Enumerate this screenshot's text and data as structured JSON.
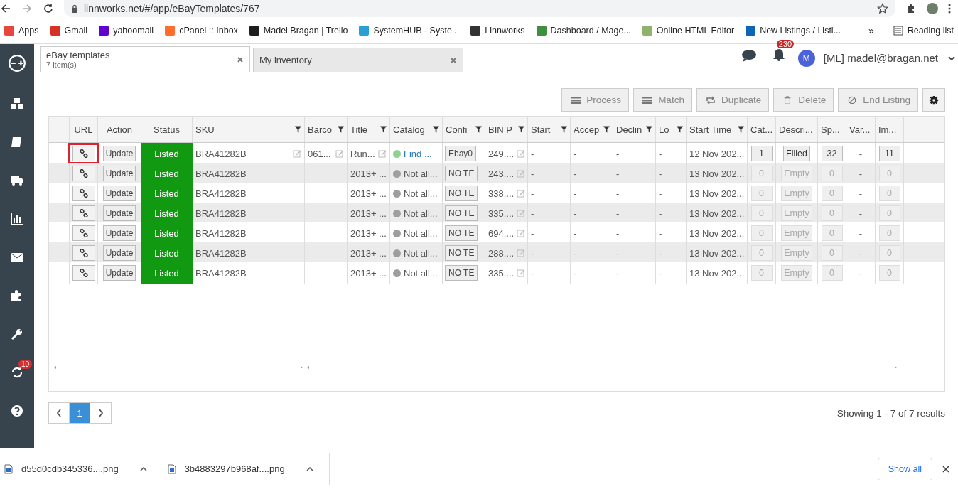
{
  "browser": {
    "url": "linnworks.net/#/app/eBayTemplates/767"
  },
  "bookmarks": [
    {
      "label": "Apps",
      "color": "#e8453c"
    },
    {
      "label": "Gmail",
      "color": "#d93025"
    },
    {
      "label": "yahoomail",
      "color": "#6001d2"
    },
    {
      "label": "cPanel :: Inbox",
      "color": "#ff6c2c"
    },
    {
      "label": "Madel Bragan | Trello",
      "color": "#1d1d1d"
    },
    {
      "label": "SystemHUB - Syste...",
      "color": "#2a9fd6"
    },
    {
      "label": "Linnworks",
      "color": "#333333"
    },
    {
      "label": "Dashboard / Mage...",
      "color": "#3f8f3f"
    },
    {
      "label": "Online HTML Editor",
      "color": "#8fb36b"
    },
    {
      "label": "New Listings / Listi...",
      "color": "#0c66b5"
    }
  ],
  "bookmarks_more": "»",
  "reading_list": "Reading list",
  "sidebar": {
    "sync_badge": "10"
  },
  "tabs": [
    {
      "title": "eBay templates",
      "subtitle": "7 item(s)",
      "selected": true
    },
    {
      "title": "My inventory",
      "selected": false
    }
  ],
  "header": {
    "notifications": "230",
    "avatar": "M",
    "user": "[ML] madel@bragan.net"
  },
  "toolbar": [
    "Process",
    "Match",
    "Duplicate",
    "Delete",
    "End Listing"
  ],
  "columns": [
    {
      "filter": false
    },
    {
      "label": "URL",
      "filter": false
    },
    {
      "label": "Action",
      "filter": false
    },
    {
      "label": "Status",
      "filter": false
    },
    {
      "label": "SKU",
      "filter": true
    },
    {
      "label": "Barco",
      "filter": true
    },
    {
      "label": "Title",
      "filter": true
    },
    {
      "label": "Catalog",
      "filter": true
    },
    {
      "label": "Confi",
      "filter": true
    },
    {
      "label": "BIN P",
      "filter": true
    },
    {
      "label": "Start",
      "filter": true
    },
    {
      "label": "Accep",
      "filter": true
    },
    {
      "label": "Declin",
      "filter": true
    },
    {
      "label": "Lo",
      "filter": true
    },
    {
      "label": "Start Time",
      "filter": true
    },
    {
      "label": "Cat...",
      "filter": false
    },
    {
      "label": "Descri...",
      "filter": false
    },
    {
      "label": "Sp...",
      "filter": false
    },
    {
      "label": "Var...",
      "filter": false
    },
    {
      "label": "Im...",
      "filter": false
    }
  ],
  "rows": [
    {
      "highlighted": true,
      "enabled": true,
      "editable": true,
      "action": "Update",
      "status": "Listed",
      "sku": "BRA41282B",
      "barcode": "061...",
      "title": "Run...",
      "catalog": {
        "text": "Find ...",
        "color": "#8fd18f",
        "link": true
      },
      "config": "Ebay0",
      "bin": "249....",
      "start_price": "-",
      "accept": "-",
      "decline": "-",
      "lo": "-",
      "start_time": "12 Nov 202...",
      "cat": "1",
      "description": "Filled",
      "sp": "32",
      "var": "-",
      "im": "11"
    },
    {
      "highlighted": false,
      "enabled": false,
      "editable": false,
      "action": "Update",
      "status": "Listed",
      "sku": "BRA41282B",
      "title": "2013+ ...",
      "catalog": {
        "text": "Not all...",
        "color": "#9e9e9e",
        "link": false
      },
      "config": "NO TE",
      "bin": "243....",
      "start_price": "-",
      "accept": "-",
      "decline": "-",
      "lo": "-",
      "start_time": "13 Nov 202...",
      "cat": "0",
      "description": "Empty",
      "sp": "0",
      "var": "-",
      "im": "0"
    },
    {
      "highlighted": false,
      "enabled": false,
      "editable": false,
      "action": "Update",
      "status": "Listed",
      "sku": "BRA41282B",
      "title": "2013+ ...",
      "catalog": {
        "text": "Not all...",
        "color": "#9e9e9e",
        "link": false
      },
      "config": "NO TE",
      "bin": "338....",
      "start_price": "-",
      "accept": "-",
      "decline": "-",
      "lo": "-",
      "start_time": "13 Nov 202...",
      "cat": "0",
      "description": "Empty",
      "sp": "0",
      "var": "-",
      "im": "0"
    },
    {
      "highlighted": false,
      "enabled": false,
      "editable": false,
      "action": "Update",
      "status": "Listed",
      "sku": "BRA41282B",
      "title": "2013+ ...",
      "catalog": {
        "text": "Not all...",
        "color": "#9e9e9e",
        "link": false
      },
      "config": "NO TE",
      "bin": "335....",
      "start_price": "-",
      "accept": "-",
      "decline": "-",
      "lo": "-",
      "start_time": "13 Nov 202...",
      "cat": "0",
      "description": "Empty",
      "sp": "0",
      "var": "-",
      "im": "0"
    },
    {
      "highlighted": false,
      "enabled": false,
      "editable": false,
      "action": "Update",
      "status": "Listed",
      "sku": "BRA41282B",
      "title": "2013+ ...",
      "catalog": {
        "text": "Not all...",
        "color": "#9e9e9e",
        "link": false
      },
      "config": "NO TE",
      "bin": "694....",
      "start_price": "-",
      "accept": "-",
      "decline": "-",
      "lo": "-",
      "start_time": "13 Nov 202...",
      "cat": "0",
      "description": "Empty",
      "sp": "0",
      "var": "-",
      "im": "0"
    },
    {
      "highlighted": false,
      "enabled": false,
      "editable": false,
      "action": "Update",
      "status": "Listed",
      "sku": "BRA41282B",
      "title": "2013+ ...",
      "catalog": {
        "text": "Not all...",
        "color": "#9e9e9e",
        "link": false
      },
      "config": "NO TE",
      "bin": "288....",
      "start_price": "-",
      "accept": "-",
      "decline": "-",
      "lo": "-",
      "start_time": "13 Nov 202...",
      "cat": "0",
      "description": "Empty",
      "sp": "0",
      "var": "-",
      "im": "0"
    },
    {
      "highlighted": false,
      "enabled": false,
      "editable": false,
      "action": "Update",
      "status": "Listed",
      "sku": "BRA41282B",
      "title": "2013+ ...",
      "catalog": {
        "text": "Not all...",
        "color": "#9e9e9e",
        "link": false
      },
      "config": "NO TE",
      "bin": "335....",
      "start_price": "-",
      "accept": "-",
      "decline": "-",
      "lo": "-",
      "start_time": "13 Nov 202...",
      "cat": "0",
      "description": "Empty",
      "sp": "0",
      "var": "-",
      "im": "0"
    }
  ],
  "pagination": {
    "pages": [
      {
        "label": "1",
        "selected": true
      }
    ],
    "summary": "Showing 1 - 7 of 7 results"
  },
  "downloads": [
    {
      "file": "d55d0cdb345336....png"
    },
    {
      "file": "3b4883297b968af....png"
    }
  ],
  "show_all": "Show all"
}
